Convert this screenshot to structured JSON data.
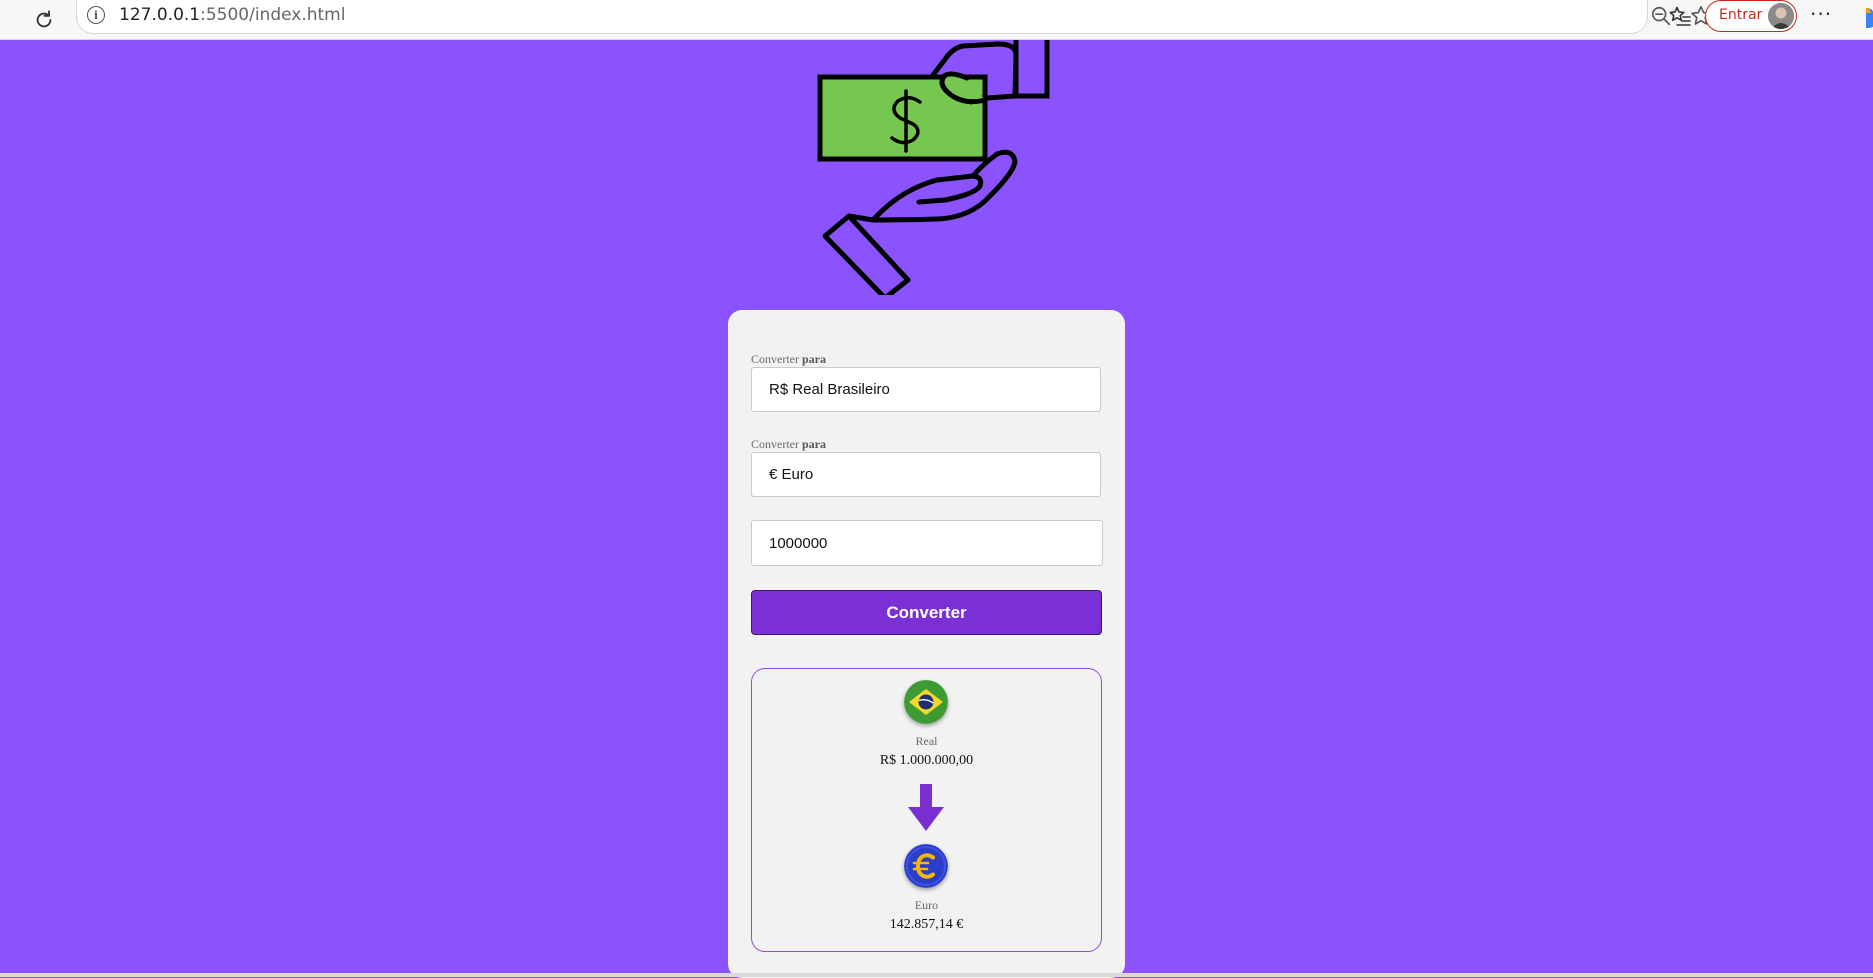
{
  "browser": {
    "url_host": "127.0.0.1",
    "url_rest": ":5500/index.html",
    "signin_label": "Entrar",
    "more_label": "···"
  },
  "form": {
    "from_label_prefix": "Converter ",
    "from_label_bold": "para",
    "from_value": "R$ Real Brasileiro",
    "to_label_prefix": "Converter ",
    "to_label_bold": "para",
    "to_value": "€ Euro",
    "amount_value": "1000000",
    "convert_label": "Converter"
  },
  "result": {
    "from_currency_name": "Real",
    "from_currency_value": "R$ 1.000.000,00",
    "to_currency_name": "Euro",
    "to_currency_value": "142.857,14 €"
  },
  "colors": {
    "page_background": "#8b53fe",
    "card_background": "#f2f2f2",
    "button_background": "#7b30d6",
    "result_border": "#8a4fe0",
    "money_green": "#76c74f"
  }
}
